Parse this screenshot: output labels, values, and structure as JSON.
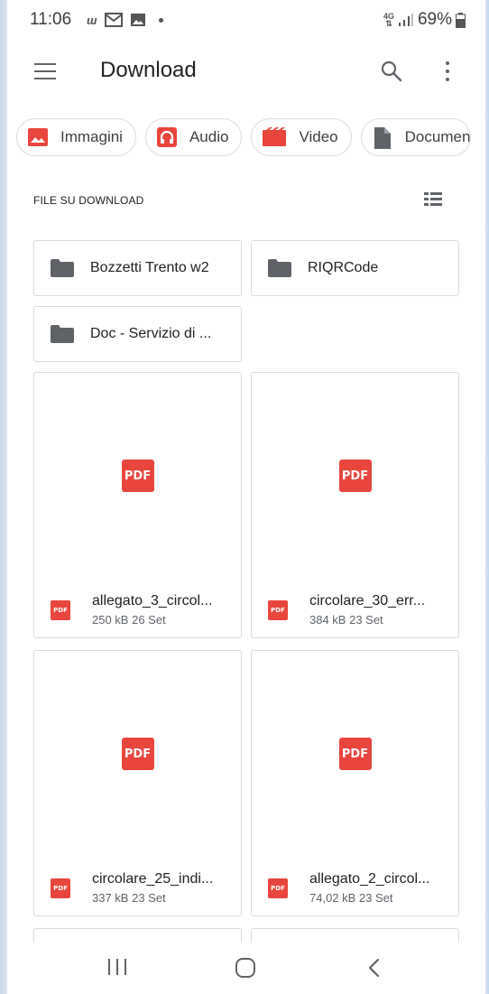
{
  "status_bar": {
    "time": "11:06",
    "network": "4G",
    "battery": "69%",
    "icons": [
      "w-icon",
      "gmail-icon",
      "gallery-icon",
      "dot-icon",
      "signal-icon",
      "battery-icon"
    ]
  },
  "app_bar": {
    "title": "Download"
  },
  "chips": [
    {
      "label": "Immagini",
      "icon": "image-icon",
      "color": "#e8453c"
    },
    {
      "label": "Audio",
      "icon": "headphones-icon",
      "color": "#e8453c"
    },
    {
      "label": "Video",
      "icon": "film-icon",
      "color": "#e8453c"
    },
    {
      "label": "Documen",
      "icon": "document-icon",
      "color": "#5f6368"
    }
  ],
  "section": {
    "title": "FILE SU DOWNLOAD"
  },
  "folders": [
    {
      "name": "Bozzetti Trento w2"
    },
    {
      "name": "RIQRCode"
    },
    {
      "name": "Doc - Servizio di ..."
    }
  ],
  "files": [
    {
      "name": "allegato_3_circol...",
      "info": "250 kB 26 Set",
      "badge": "PDF"
    },
    {
      "name": "circolare_30_err...",
      "info": "384 kB 23 Set",
      "badge": "PDF"
    },
    {
      "name": "circolare_25_indi...",
      "info": "337 kB 23 Set",
      "badge": "PDF"
    },
    {
      "name": "allegato_2_circol...",
      "info": "74,02 kB 23 Set",
      "badge": "PDF"
    }
  ],
  "colors": {
    "pdf_red": "#e8453c",
    "border": "#dadce0",
    "icon_grey": "#5f6368"
  }
}
